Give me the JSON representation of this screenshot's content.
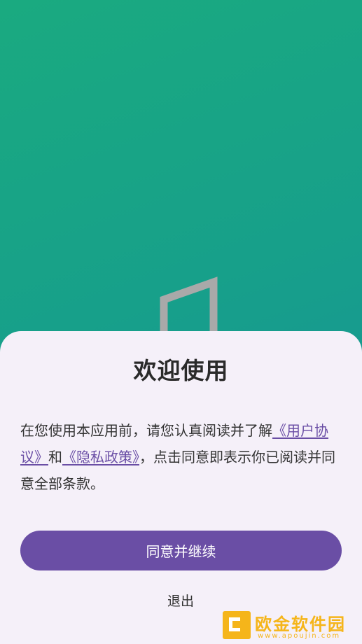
{
  "dialog": {
    "title": "欢迎使用",
    "text_before": "在您使用本应用前，请您认真阅读并了解",
    "user_agreement_link": "《用户协议》",
    "text_and": "和",
    "privacy_policy_link": "《隐私政策》",
    "text_after": "，点击同意即表示你已阅读并同意全部条款。",
    "agree_button": "同意并继续",
    "exit_button": "退出"
  },
  "watermark": {
    "name": "欧金软件园",
    "url": "www.apoujin.com"
  },
  "colors": {
    "background_gradient_start": "#1aaa80",
    "background_gradient_end": "#168f9a",
    "sheet_background": "#f5f0f9",
    "accent": "#6a4ea5",
    "watermark": "#f5b51a"
  }
}
